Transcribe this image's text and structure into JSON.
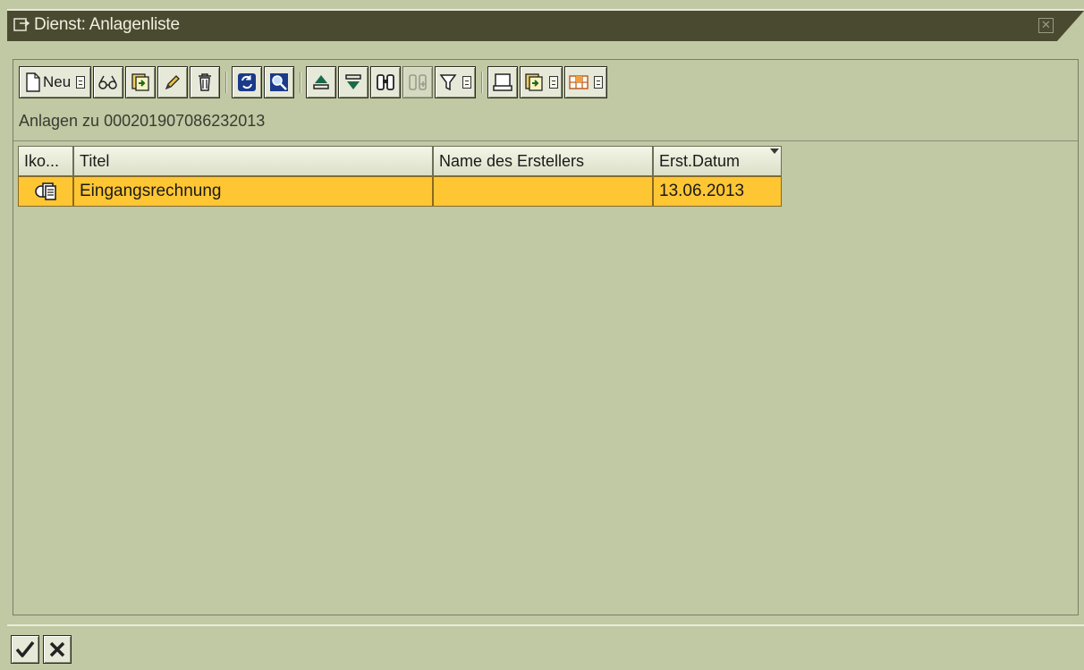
{
  "window": {
    "title": "Dienst: Anlagenliste"
  },
  "toolbar": {
    "new_label": "Neu"
  },
  "list": {
    "subtitle": "Anlagen zu 000201907086232013"
  },
  "table": {
    "columns": [
      "Iko...",
      "Titel",
      "Name des Erstellers",
      "Erst.Datum"
    ],
    "sorted_column": "Erst.Datum",
    "rows": [
      {
        "icon": "document-stack-icon",
        "title": "Eingangsrechnung",
        "creator": "",
        "date": "13.06.2013"
      }
    ]
  },
  "colors": {
    "selected_row": "#ffc634",
    "background": "#c0c8a4",
    "titlebar": "#4a4a30"
  }
}
